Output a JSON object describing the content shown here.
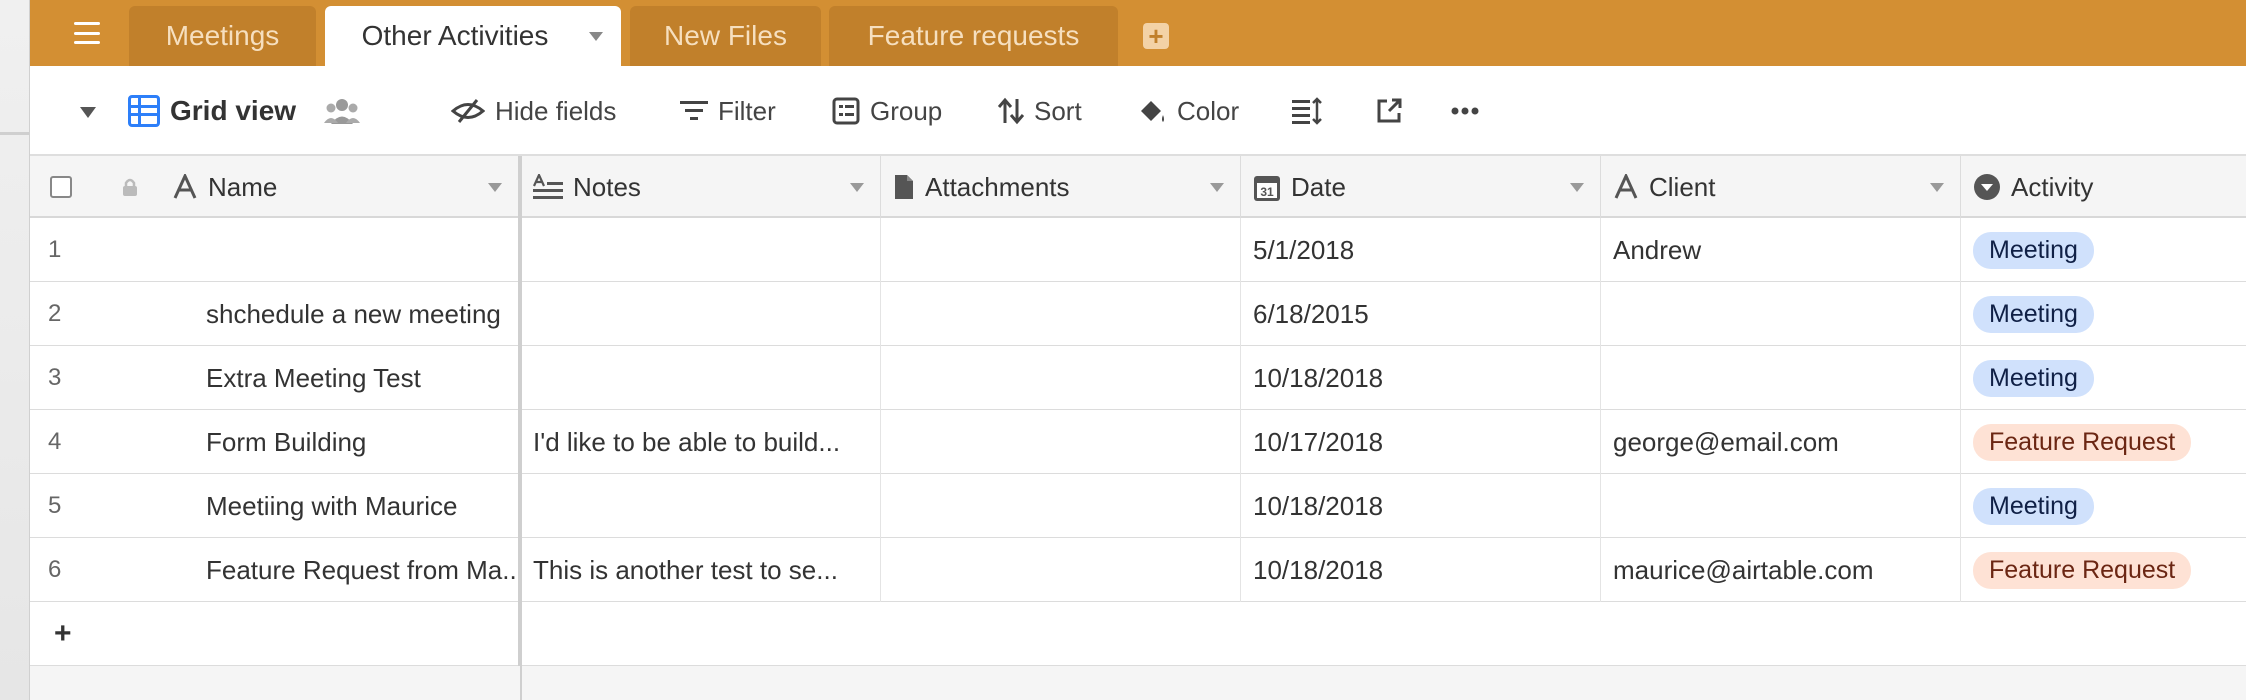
{
  "tabs": [
    {
      "label": "Meetings"
    },
    {
      "label": "Other Activities"
    },
    {
      "label": "New Files"
    },
    {
      "label": "Feature requests"
    }
  ],
  "toolbar": {
    "view_name": "Grid view",
    "hide_fields": "Hide fields",
    "filter": "Filter",
    "group": "Group",
    "sort": "Sort",
    "color": "Color"
  },
  "columns": [
    {
      "label": "Name"
    },
    {
      "label": "Notes"
    },
    {
      "label": "Attachments"
    },
    {
      "label": "Date"
    },
    {
      "label": "Client"
    },
    {
      "label": "Activity"
    }
  ],
  "rows": [
    {
      "num": "1",
      "name": "",
      "notes": "",
      "attachments": "",
      "date": "5/1/2018",
      "client": "Andrew",
      "activity": "Meeting"
    },
    {
      "num": "2",
      "name": "shchedule a new meeting",
      "notes": "",
      "attachments": "",
      "date": "6/18/2015",
      "client": "",
      "activity": "Meeting"
    },
    {
      "num": "3",
      "name": "Extra Meeting Test",
      "notes": "",
      "attachments": "",
      "date": "10/18/2018",
      "client": "",
      "activity": "Meeting"
    },
    {
      "num": "4",
      "name": "Form Building",
      "notes": "I'd like to be able to build...",
      "attachments": "",
      "date": "10/17/2018",
      "client": "george@email.com",
      "activity": "Feature Request"
    },
    {
      "num": "5",
      "name": "Meetiing with Maurice",
      "notes": "",
      "attachments": "",
      "date": "10/18/2018",
      "client": "",
      "activity": "Meeting"
    },
    {
      "num": "6",
      "name": "Feature Request from Ma...",
      "notes": "This is another test to se...",
      "attachments": "",
      "date": "10/18/2018",
      "client": "maurice@airtable.com",
      "activity": "Feature Request"
    }
  ],
  "add_row": "+",
  "colors": {
    "tabbar": "#d38f33",
    "meeting_pill_bg": "#d0e1fc",
    "meeting_pill_fg": "#102046",
    "feature_pill_bg": "#fee2d5",
    "feature_pill_fg": "#6b2613",
    "accent_blue": "#2d7ff9"
  }
}
